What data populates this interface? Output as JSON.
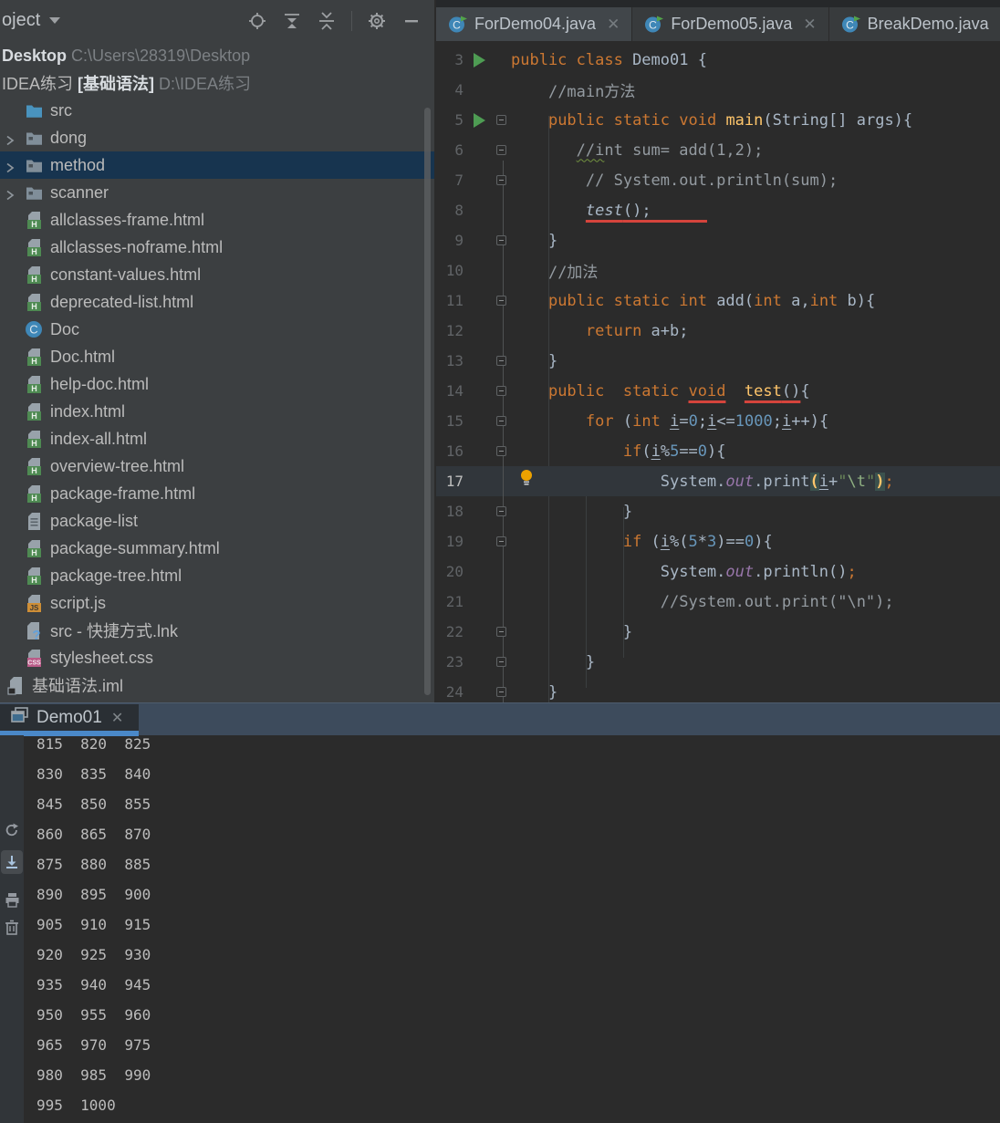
{
  "project_panel": {
    "title": "oject",
    "toolbar_icons": [
      "locate-icon",
      "scroll-from-source-icon",
      "collapse-all-icon",
      "settings-icon",
      "hide-panel-icon"
    ],
    "tree": [
      {
        "icon": null,
        "chev": false,
        "x": 2,
        "sel": false,
        "segs": [
          [
            "lb",
            "Desktop"
          ],
          [
            "pt",
            " C:\\Users\\28319\\Desktop"
          ]
        ]
      },
      {
        "icon": null,
        "chev": false,
        "x": 2,
        "sel": false,
        "segs": [
          [
            "lt",
            "IDEA练习 "
          ],
          [
            "lb",
            "[基础语法]"
          ],
          [
            "pt",
            " D:\\IDEA练习"
          ]
        ]
      },
      {
        "icon": "folder_src",
        "chev": false,
        "x": 26,
        "sel": false,
        "segs": [
          [
            "lt",
            "src"
          ]
        ]
      },
      {
        "icon": "folder",
        "chev": true,
        "x": 26,
        "sel": false,
        "segs": [
          [
            "lt",
            "dong"
          ]
        ]
      },
      {
        "icon": "folder",
        "chev": true,
        "x": 26,
        "sel": true,
        "segs": [
          [
            "lt",
            "method"
          ]
        ]
      },
      {
        "icon": "folder",
        "chev": true,
        "x": 26,
        "sel": false,
        "segs": [
          [
            "lt",
            "scanner"
          ]
        ]
      },
      {
        "icon": "html",
        "chev": false,
        "x": 26,
        "sel": false,
        "segs": [
          [
            "lt",
            "allclasses-frame.html"
          ]
        ]
      },
      {
        "icon": "html",
        "chev": false,
        "x": 26,
        "sel": false,
        "segs": [
          [
            "lt",
            "allclasses-noframe.html"
          ]
        ]
      },
      {
        "icon": "html",
        "chev": false,
        "x": 26,
        "sel": false,
        "segs": [
          [
            "lt",
            "constant-values.html"
          ]
        ]
      },
      {
        "icon": "html",
        "chev": false,
        "x": 26,
        "sel": false,
        "segs": [
          [
            "lt",
            "deprecated-list.html"
          ]
        ]
      },
      {
        "icon": "class",
        "chev": false,
        "x": 26,
        "sel": false,
        "segs": [
          [
            "lt",
            "Doc"
          ]
        ]
      },
      {
        "icon": "html",
        "chev": false,
        "x": 26,
        "sel": false,
        "segs": [
          [
            "lt",
            "Doc.html"
          ]
        ]
      },
      {
        "icon": "html",
        "chev": false,
        "x": 26,
        "sel": false,
        "segs": [
          [
            "lt",
            "help-doc.html"
          ]
        ]
      },
      {
        "icon": "html",
        "chev": false,
        "x": 26,
        "sel": false,
        "segs": [
          [
            "lt",
            "index.html"
          ]
        ]
      },
      {
        "icon": "html",
        "chev": false,
        "x": 26,
        "sel": false,
        "segs": [
          [
            "lt",
            "index-all.html"
          ]
        ]
      },
      {
        "icon": "html",
        "chev": false,
        "x": 26,
        "sel": false,
        "segs": [
          [
            "lt",
            "overview-tree.html"
          ]
        ]
      },
      {
        "icon": "html",
        "chev": false,
        "x": 26,
        "sel": false,
        "segs": [
          [
            "lt",
            "package-frame.html"
          ]
        ]
      },
      {
        "icon": "txt",
        "chev": false,
        "x": 26,
        "sel": false,
        "segs": [
          [
            "lt",
            "package-list"
          ]
        ]
      },
      {
        "icon": "html",
        "chev": false,
        "x": 26,
        "sel": false,
        "segs": [
          [
            "lt",
            "package-summary.html"
          ]
        ]
      },
      {
        "icon": "html",
        "chev": false,
        "x": 26,
        "sel": false,
        "segs": [
          [
            "lt",
            "package-tree.html"
          ]
        ]
      },
      {
        "icon": "js",
        "chev": false,
        "x": 26,
        "sel": false,
        "segs": [
          [
            "lt",
            "script.js"
          ]
        ]
      },
      {
        "icon": "lnk",
        "chev": false,
        "x": 26,
        "sel": false,
        "segs": [
          [
            "lt",
            "src - 快捷方式.lnk"
          ]
        ]
      },
      {
        "icon": "css",
        "chev": false,
        "x": 26,
        "sel": false,
        "segs": [
          [
            "lt",
            "stylesheet.css"
          ]
        ]
      },
      {
        "icon": "iml",
        "chev": false,
        "x": 6,
        "sel": false,
        "segs": [
          [
            "lt",
            "基础语法.iml"
          ]
        ]
      }
    ]
  },
  "editor": {
    "tabs": [
      {
        "label": "ForDemo04.java",
        "close": true,
        "active": true
      },
      {
        "label": "ForDemo05.java",
        "close": true,
        "active": false
      },
      {
        "label": "BreakDemo.java",
        "close": false,
        "active": false
      }
    ],
    "lines": [
      {
        "n": 3,
        "g": "run",
        "t": [
          [
            "k",
            "public class"
          ],
          [
            "p",
            " Demo01 {"
          ]
        ]
      },
      {
        "n": 4,
        "g": "",
        "t": [
          [
            "p",
            "    "
          ],
          [
            "c",
            "//main方法"
          ]
        ]
      },
      {
        "n": 5,
        "g": "run fold",
        "t": [
          [
            "p",
            "    "
          ],
          [
            "k",
            "public static void"
          ],
          [
            "p",
            " "
          ],
          [
            "m",
            "main"
          ],
          [
            "p",
            "(String[] args){"
          ]
        ]
      },
      {
        "n": 6,
        "g": "fold",
        "t": [
          [
            "p",
            "       "
          ],
          [
            "c sq",
            "//i"
          ],
          [
            "c",
            "nt sum= add(1,2);"
          ]
        ]
      },
      {
        "n": 7,
        "g": "fold",
        "t": [
          [
            "p",
            "        "
          ],
          [
            "c",
            "// System.out.println(sum);"
          ]
        ]
      },
      {
        "n": 8,
        "g": "",
        "t": [
          [
            "p",
            "        "
          ],
          [
            "p rl it",
            "test"
          ],
          [
            "p rl",
            "();      "
          ]
        ]
      },
      {
        "n": 9,
        "g": "fold",
        "t": [
          [
            "p",
            "    }"
          ]
        ]
      },
      {
        "n": 10,
        "g": "",
        "t": [
          [
            "p",
            "    "
          ],
          [
            "c",
            "//加法"
          ]
        ]
      },
      {
        "n": 11,
        "g": "fold",
        "t": [
          [
            "p",
            "    "
          ],
          [
            "k",
            "public static int"
          ],
          [
            "p",
            " add("
          ],
          [
            "k",
            "int"
          ],
          [
            "p",
            " a,"
          ],
          [
            "k",
            "int"
          ],
          [
            "p",
            " b){"
          ]
        ]
      },
      {
        "n": 12,
        "g": "",
        "t": [
          [
            "p",
            "        "
          ],
          [
            "k",
            "return"
          ],
          [
            "p",
            " a+b;"
          ]
        ]
      },
      {
        "n": 13,
        "g": "fold",
        "t": [
          [
            "p",
            "    }"
          ]
        ]
      },
      {
        "n": 14,
        "g": "fold",
        "t": [
          [
            "p",
            "    "
          ],
          [
            "k",
            "public  static "
          ],
          [
            "k rl",
            "void"
          ],
          [
            "p",
            "  "
          ],
          [
            "m rl",
            "test"
          ],
          [
            "p rl",
            "()"
          ],
          [
            "p",
            "{"
          ]
        ]
      },
      {
        "n": 15,
        "g": "fold",
        "t": [
          [
            "p",
            "        "
          ],
          [
            "k",
            "for"
          ],
          [
            "p",
            " ("
          ],
          [
            "k",
            "int"
          ],
          [
            "p",
            " "
          ],
          [
            "u",
            "i"
          ],
          [
            "p",
            "="
          ],
          [
            "n",
            "0"
          ],
          [
            "p",
            ";"
          ],
          [
            "u",
            "i"
          ],
          [
            "p",
            "<="
          ],
          [
            "n",
            "1000"
          ],
          [
            "p",
            ";"
          ],
          [
            "u",
            "i"
          ],
          [
            "p",
            "++){"
          ]
        ]
      },
      {
        "n": 16,
        "g": "fold",
        "t": [
          [
            "p",
            "            "
          ],
          [
            "k",
            "if"
          ],
          [
            "p",
            "("
          ],
          [
            "u",
            "i"
          ],
          [
            "p",
            "%"
          ],
          [
            "n",
            "5"
          ],
          [
            "p",
            "=="
          ],
          [
            "n",
            "0"
          ],
          [
            "p",
            "){"
          ]
        ]
      },
      {
        "n": 17,
        "g": "bulb",
        "cur": true,
        "t": [
          [
            "p",
            "                System."
          ],
          [
            "f",
            "out"
          ],
          [
            "p",
            ".print"
          ],
          [
            "pm",
            "("
          ],
          [
            "u",
            "i"
          ],
          [
            "p",
            "+"
          ],
          [
            "s",
            "\""
          ],
          [
            "e",
            "\\t"
          ],
          [
            "s",
            "\""
          ],
          [
            "pm",
            ")"
          ],
          [
            "k",
            ";"
          ]
        ]
      },
      {
        "n": 18,
        "g": "fold",
        "t": [
          [
            "p",
            "            }"
          ]
        ]
      },
      {
        "n": 19,
        "g": "fold",
        "t": [
          [
            "p",
            "            "
          ],
          [
            "k",
            "if"
          ],
          [
            "p",
            " ("
          ],
          [
            "u",
            "i"
          ],
          [
            "p",
            "%("
          ],
          [
            "n",
            "5"
          ],
          [
            "p",
            "*"
          ],
          [
            "n",
            "3"
          ],
          [
            "p",
            ")=="
          ],
          [
            "n",
            "0"
          ],
          [
            "p",
            "){"
          ]
        ]
      },
      {
        "n": 20,
        "g": "",
        "t": [
          [
            "p",
            "                System."
          ],
          [
            "f",
            "out"
          ],
          [
            "p",
            ".println()"
          ],
          [
            "k",
            ";"
          ]
        ]
      },
      {
        "n": 21,
        "g": "",
        "t": [
          [
            "p",
            "                "
          ],
          [
            "c",
            "//System.out.print(\"\\n\");"
          ]
        ]
      },
      {
        "n": 22,
        "g": "fold",
        "t": [
          [
            "p",
            "            }"
          ]
        ]
      },
      {
        "n": 23,
        "g": "fold",
        "t": [
          [
            "p",
            "        }"
          ]
        ]
      },
      {
        "n": 24,
        "g": "fold",
        "t": [
          [
            "p",
            "    }"
          ]
        ]
      }
    ]
  },
  "run_panel": {
    "tab_label": "Demo01",
    "toolbar_icons": [
      "rerun-icon",
      "scroll-to-end-icon",
      "print-icon",
      "clear-icon"
    ],
    "console_lines": [
      "815  820  825",
      "830  835  840",
      "845  850  855",
      "860  865  870",
      "875  880  885",
      "890  895  900",
      "905  910  915",
      "920  925  930",
      "935  940  945",
      "950  955  960",
      "965  970  975",
      "980  985  990",
      "995  1000"
    ]
  }
}
